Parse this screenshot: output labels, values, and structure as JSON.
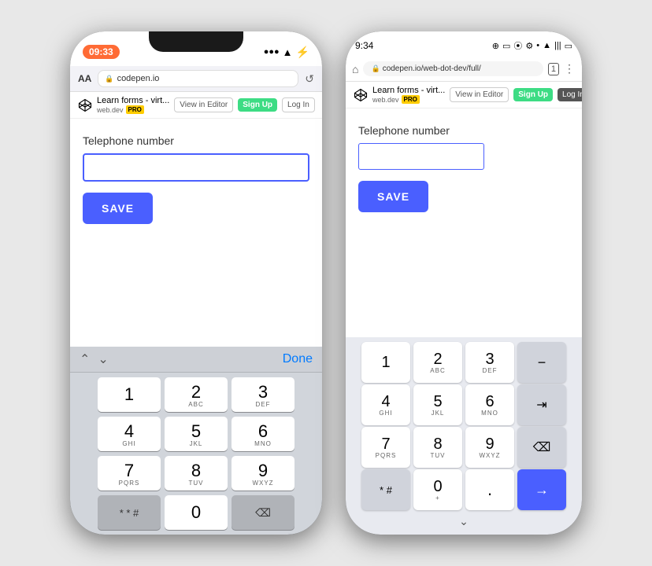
{
  "left_phone": {
    "status_time": "09:33",
    "browser": {
      "aa": "AA",
      "url": "codepen.io",
      "lock": "🔒"
    },
    "codepen_bar": {
      "title": "Learn forms - virt...",
      "domain": "web.dev",
      "pro": "PRO",
      "view_in_editor": "View in Editor",
      "sign_up": "Sign Up",
      "log_in": "Log In"
    },
    "page": {
      "telephone_label": "Telephone number",
      "save": "SAVE"
    },
    "keyboard": {
      "done": "Done",
      "keys": [
        {
          "main": "1",
          "sub": ""
        },
        {
          "main": "2",
          "sub": "ABC"
        },
        {
          "main": "3",
          "sub": "DEF"
        },
        {
          "main": "4",
          "sub": "GHI"
        },
        {
          "main": "5",
          "sub": "JKL"
        },
        {
          "main": "6",
          "sub": "MNO"
        },
        {
          "main": "7",
          "sub": "PQRS"
        },
        {
          "main": "8",
          "sub": "TUV"
        },
        {
          "main": "9",
          "sub": "WXYZ"
        },
        {
          "main": "* # #",
          "sub": ""
        },
        {
          "main": "0",
          "sub": ""
        },
        {
          "main": "⌫",
          "sub": ""
        }
      ]
    }
  },
  "right_phone": {
    "status_time": "9:34",
    "browser": {
      "url": "codepen.io/web-dot-dev/full/",
      "lock": "🔒"
    },
    "codepen_bar": {
      "title": "Learn forms - virt...",
      "domain": "web.dev",
      "pro": "PRO",
      "view_in_editor": "View in Editor",
      "sign_up": "Sign Up",
      "log_in": "Log In"
    },
    "page": {
      "telephone_label": "Telephone number",
      "save": "SAVE"
    },
    "keyboard": {
      "keys": [
        {
          "main": "1",
          "sub": ""
        },
        {
          "main": "2",
          "sub": "ABC"
        },
        {
          "main": "3",
          "sub": "DEF"
        },
        {
          "main": "4",
          "sub": "GHI"
        },
        {
          "main": "5",
          "sub": "JKL"
        },
        {
          "main": "6",
          "sub": "MNO"
        },
        {
          "main": "7",
          "sub": "PQRS"
        },
        {
          "main": "8",
          "sub": "TUV"
        },
        {
          "main": "9",
          "sub": "WXYZ"
        },
        {
          "main": "* #",
          "sub": ""
        },
        {
          "main": "0",
          "sub": "+"
        },
        {
          "main": ".",
          "sub": ""
        }
      ]
    }
  },
  "colors": {
    "accent": "#4a5fff",
    "green": "#3ddc84",
    "ios_keyboard_bg": "#d1d5db",
    "android_keyboard_bg": "#e8eaf0"
  }
}
